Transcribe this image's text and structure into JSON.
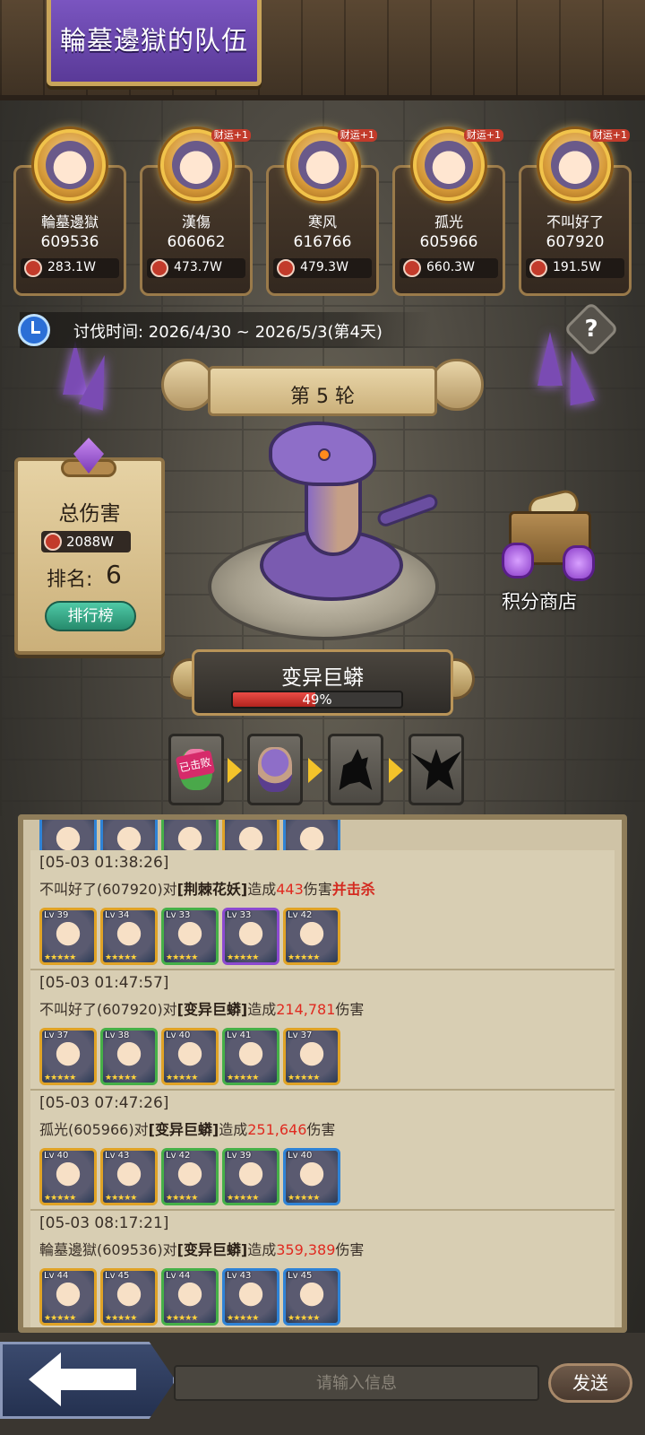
{
  "team_title": "輪墓邊獄的队伍",
  "members": [
    {
      "name": "輪墓邊獄",
      "uid": "609536",
      "damage": "283.1W",
      "badge": ""
    },
    {
      "name": "漢傷",
      "uid": "606062",
      "damage": "473.7W",
      "badge": "财运+1"
    },
    {
      "name": "寒风",
      "uid": "616766",
      "damage": "479.3W",
      "badge": "财运+1"
    },
    {
      "name": "孤光",
      "uid": "605966",
      "damage": "660.3W",
      "badge": "财运+1"
    },
    {
      "name": "不叫好了",
      "uid": "607920",
      "damage": "191.5W",
      "badge": "财运+1"
    }
  ],
  "time_text": "讨伐时间: 2026/4/30 ~ 2026/5/3(第4天)",
  "help_symbol": "?",
  "round_label": "第 5 轮",
  "total_damage": {
    "label": "总伤害",
    "value": "2088W"
  },
  "rank": {
    "label": "排名:",
    "value": "6",
    "button": "排行榜"
  },
  "shop_label": "积分商店",
  "boss": {
    "name": "变异巨蟒",
    "hp_percent": 49,
    "hp_text": "49%"
  },
  "stages": [
    {
      "name": "荆棘花妖",
      "status": "已击败"
    },
    {
      "name": "变异巨蟒",
      "status": ""
    },
    {
      "name": "wolf",
      "status": ""
    },
    {
      "name": "griffin",
      "status": ""
    }
  ],
  "log": [
    {
      "time": "[05-03 01:38:26]",
      "actor": "不叫好了(607920)对",
      "target": "[荆棘花妖]",
      "verb": "造成",
      "damage": "443",
      "suffix": "伤害",
      "extra": "并击杀",
      "heroes": [
        {
          "lv": "Lv 39",
          "frame": "gold"
        },
        {
          "lv": "Lv 34",
          "frame": "gold"
        },
        {
          "lv": "Lv 33",
          "frame": "green"
        },
        {
          "lv": "Lv 33",
          "frame": "purple"
        },
        {
          "lv": "Lv 42",
          "frame": "gold"
        }
      ]
    },
    {
      "time": "[05-03 01:47:57]",
      "actor": "不叫好了(607920)对",
      "target": "[变异巨蟒]",
      "verb": "造成",
      "damage": "214,781",
      "suffix": "伤害",
      "extra": "",
      "heroes": [
        {
          "lv": "Lv 37",
          "frame": "gold"
        },
        {
          "lv": "Lv 38",
          "frame": "green"
        },
        {
          "lv": "Lv 40",
          "frame": "gold"
        },
        {
          "lv": "Lv 41",
          "frame": "green"
        },
        {
          "lv": "Lv 37",
          "frame": "gold"
        }
      ]
    },
    {
      "time": "[05-03 07:47:26]",
      "actor": "孤光(605966)对",
      "target": "[变异巨蟒]",
      "verb": "造成",
      "damage": "251,646",
      "suffix": "伤害",
      "extra": "",
      "heroes": [
        {
          "lv": "Lv 40",
          "frame": "gold"
        },
        {
          "lv": "Lv 43",
          "frame": "gold"
        },
        {
          "lv": "Lv 42",
          "frame": "green"
        },
        {
          "lv": "Lv 39",
          "frame": "green"
        },
        {
          "lv": "Lv 40",
          "frame": "blue"
        }
      ]
    },
    {
      "time": "[05-03 08:17:21]",
      "actor": "輪墓邊獄(609536)对",
      "target": "[变异巨蟒]",
      "verb": "造成",
      "damage": "359,389",
      "suffix": "伤害",
      "extra": "",
      "heroes": [
        {
          "lv": "Lv 44",
          "frame": "gold"
        },
        {
          "lv": "Lv 45",
          "frame": "gold"
        },
        {
          "lv": "Lv 44",
          "frame": "green"
        },
        {
          "lv": "Lv 43",
          "frame": "blue"
        },
        {
          "lv": "Lv 45",
          "frame": "blue"
        }
      ]
    }
  ],
  "input_placeholder": "请输入信息",
  "send_label": "发送",
  "colors": {
    "accent_purple": "#7a55c0",
    "hp_red": "#ea4c46",
    "damage_red": "#e02a20",
    "frame_gold": "#e0a326"
  }
}
